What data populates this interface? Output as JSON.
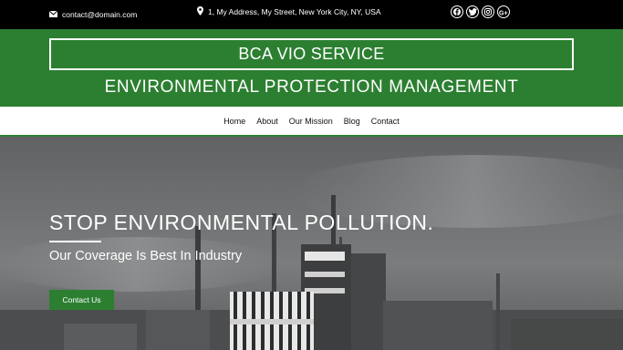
{
  "topbar": {
    "email": "contact@domain.com",
    "address": "1, My Address, My Street, New York City, NY, USA",
    "socials": [
      {
        "icon": "facebook-icon",
        "glyph": "f"
      },
      {
        "icon": "twitter-icon",
        "glyph": "t"
      },
      {
        "icon": "instagram-icon",
        "glyph": "◎"
      },
      {
        "icon": "google-plus-icon",
        "glyph": "G+"
      }
    ]
  },
  "header": {
    "brand": "BCA VIO SERVICE",
    "tagline": "ENVIRONMENTAL PROTECTION MANAGEMENT",
    "color": "#2c7f31"
  },
  "nav": {
    "items": [
      "Home",
      "About",
      "Our Mission",
      "Blog",
      "Contact"
    ]
  },
  "hero": {
    "title": "STOP ENVIRONMENTAL POLLUTION.",
    "subtitle": "Our Coverage Is Best In Industry",
    "cta": "Contact Us"
  }
}
